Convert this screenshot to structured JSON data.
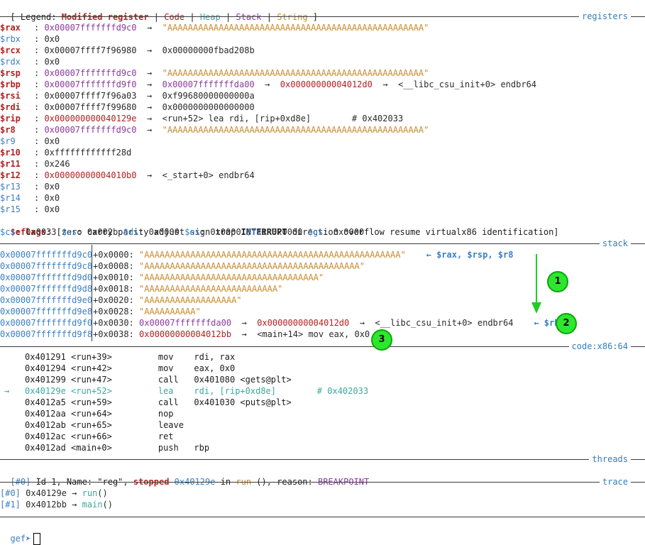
{
  "legend": {
    "open": "[ Legend: ",
    "modified": "Modified register",
    "sep": " | ",
    "code": "Code",
    "heap": "Heap",
    "stack": "Stack",
    "string": "String",
    "close": " ]"
  },
  "sections": {
    "registers": "registers",
    "stack": "stack",
    "code": "code:x86:64",
    "threads": "threads",
    "trace": "trace"
  },
  "registers": [
    {
      "name": "$rax",
      "mod": true,
      "value": "0x00007fffffffd9c0",
      "vclass": "purple",
      "chain": [
        {
          "t": "  →  ",
          "c": "ln"
        },
        {
          "t": "\"AAAAAAAAAAAAAAAAAAAAAAAAAAAAAAAAAAAAAAAAAAAAAAAAAA\"",
          "c": "str"
        }
      ]
    },
    {
      "name": "$rbx",
      "mod": false,
      "value": "0x0",
      "vclass": "ln",
      "chain": []
    },
    {
      "name": "$rcx",
      "mod": true,
      "value": "0x00007ffff7f96980",
      "vclass": "ln",
      "chain": [
        {
          "t": "  →  0x00000000fbad208b",
          "c": "ln"
        }
      ]
    },
    {
      "name": "$rdx",
      "mod": false,
      "value": "0x0",
      "vclass": "ln",
      "chain": []
    },
    {
      "name": "$rsp",
      "mod": true,
      "value": "0x00007fffffffd9c0",
      "vclass": "purple",
      "chain": [
        {
          "t": "  →  ",
          "c": "ln"
        },
        {
          "t": "\"AAAAAAAAAAAAAAAAAAAAAAAAAAAAAAAAAAAAAAAAAAAAAAAAAA\"",
          "c": "str"
        }
      ]
    },
    {
      "name": "$rbp",
      "mod": true,
      "value": "0x00007fffffffd9f0",
      "vclass": "purple",
      "chain": [
        {
          "t": "  →  ",
          "c": "ln"
        },
        {
          "t": "0x00007fffffffda00",
          "c": "purple"
        },
        {
          "t": "  →  ",
          "c": "ln"
        },
        {
          "t": "0x00000000004012d0",
          "c": "red"
        },
        {
          "t": "  →  <__libc_csu_init+0> endbr64",
          "c": "ln"
        }
      ]
    },
    {
      "name": "$rsi",
      "mod": true,
      "value": "0x00007ffff7f96a03",
      "vclass": "ln",
      "chain": [
        {
          "t": "  →  0xf99680000000000a",
          "c": "ln"
        }
      ]
    },
    {
      "name": "$rdi",
      "mod": true,
      "value": "0x00007ffff7f99680",
      "vclass": "ln",
      "chain": [
        {
          "t": "  →  0x0000000000000000",
          "c": "ln"
        }
      ]
    },
    {
      "name": "$rip",
      "mod": true,
      "value": "0x000000000040129e",
      "vclass": "red",
      "chain": [
        {
          "t": "  →  <run+52> lea rdi, [rip+0xd8e]        # 0x402033",
          "c": "ln"
        }
      ]
    },
    {
      "name": "$r8",
      "mod": true,
      "value": "0x00007fffffffd9c0",
      "vclass": "purple",
      "chain": [
        {
          "t": "  →  ",
          "c": "ln"
        },
        {
          "t": "\"AAAAAAAAAAAAAAAAAAAAAAAAAAAAAAAAAAAAAAAAAAAAAAAAAA\"",
          "c": "str"
        }
      ]
    },
    {
      "name": "$r9",
      "mod": false,
      "value": "0x0",
      "vclass": "ln",
      "chain": []
    },
    {
      "name": "$r10",
      "mod": true,
      "value": "0xffffffffffff28d",
      "vclass": "ln",
      "chain": []
    },
    {
      "name": "$r11",
      "mod": true,
      "value": "0x246",
      "vclass": "ln",
      "chain": []
    },
    {
      "name": "$r12",
      "mod": true,
      "value": "0x00000000004010b0",
      "vclass": "red",
      "chain": [
        {
          "t": "  →  <_start+0> endbr64",
          "c": "ln"
        }
      ]
    },
    {
      "name": "$r13",
      "mod": false,
      "value": "0x0",
      "vclass": "ln",
      "chain": []
    },
    {
      "name": "$r14",
      "mod": false,
      "value": "0x0",
      "vclass": "ln",
      "chain": []
    },
    {
      "name": "$r15",
      "mod": false,
      "value": "0x0",
      "vclass": "ln",
      "chain": []
    }
  ],
  "eflags": {
    "name": "$eflags",
    "pre": ": [zero carry parity adjust sign trap ",
    "bold": "INTERRUPT",
    "post": " direction overflow resume virtualx86 identification]"
  },
  "segments": [
    {
      "name": "$cs",
      "value": "0x0033"
    },
    {
      "name": "$ss",
      "value": "0x002b"
    },
    {
      "name": "$ds",
      "value": "0x0000"
    },
    {
      "name": "$es",
      "value": "0x0000"
    },
    {
      "name": "$fs",
      "value": "0x0000"
    },
    {
      "name": "$gs",
      "value": "0x0000"
    }
  ],
  "stack": [
    {
      "addr": "0x00007fffffffd9c0",
      "off": "+0x0000: ",
      "parts": [
        {
          "t": "\"AAAAAAAAAAAAAAAAAAAAAAAAAAAAAAAAAAAAAAAAAAAAAAAAAA\"",
          "c": "str"
        }
      ],
      "note": "    ← $rax, $rsp, $r8"
    },
    {
      "addr": "0x00007fffffffd9c8",
      "off": "+0x0008: ",
      "parts": [
        {
          "t": "\"AAAAAAAAAAAAAAAAAAAAAAAAAAAAAAAAAAAAAAAAAA\"",
          "c": "str"
        }
      ],
      "note": ""
    },
    {
      "addr": "0x00007fffffffd9d0",
      "off": "+0x0010: ",
      "parts": [
        {
          "t": "\"AAAAAAAAAAAAAAAAAAAAAAAAAAAAAAAAAA\"",
          "c": "str"
        }
      ],
      "note": ""
    },
    {
      "addr": "0x00007fffffffd9d8",
      "off": "+0x0018: ",
      "parts": [
        {
          "t": "\"AAAAAAAAAAAAAAAAAAAAAAAAAA\"",
          "c": "str"
        }
      ],
      "note": ""
    },
    {
      "addr": "0x00007fffffffd9e0",
      "off": "+0x0020: ",
      "parts": [
        {
          "t": "\"AAAAAAAAAAAAAAAAAA\"",
          "c": "str"
        }
      ],
      "note": ""
    },
    {
      "addr": "0x00007fffffffd9e8",
      "off": "+0x0028: ",
      "parts": [
        {
          "t": "\"AAAAAAAAAA\"",
          "c": "str"
        }
      ],
      "note": ""
    },
    {
      "addr": "0x00007fffffffd9f0",
      "off": "+0x0030: ",
      "parts": [
        {
          "t": "0x00007fffffffda00",
          "c": "purple"
        },
        {
          "t": "  →  ",
          "c": "ln"
        },
        {
          "t": "0x00000000004012d0",
          "c": "red"
        },
        {
          "t": "  →  <__libc_csu_init+0> endbr64",
          "c": "ln"
        }
      ],
      "note": "    ← $rbp"
    },
    {
      "addr": "0x00007fffffffd9f8",
      "off": "+0x0038: ",
      "parts": [
        {
          "t": "0x00000000004012bb",
          "c": "red"
        },
        {
          "t": "  →  <main+14> mov eax, 0x0",
          "c": "ln"
        }
      ],
      "note": ""
    }
  ],
  "code": [
    {
      "current": false,
      "text": "0x401291 <run+39>         mov    rdi, rax"
    },
    {
      "current": false,
      "text": "0x401294 <run+42>         mov    eax, 0x0"
    },
    {
      "current": false,
      "text": "0x401299 <run+47>         call   0x401080 <gets@plt>"
    },
    {
      "current": true,
      "text": "0x40129e <run+52>         lea    rdi, [rip+0xd8e]        # 0x402033"
    },
    {
      "current": false,
      "text": "0x4012a5 <run+59>         call   0x401030 <puts@plt>"
    },
    {
      "current": false,
      "text": "0x4012aa <run+64>         nop"
    },
    {
      "current": false,
      "text": "0x4012ab <run+65>         leave"
    },
    {
      "current": false,
      "text": "0x4012ac <run+66>         ret"
    },
    {
      "current": false,
      "text": "0x4012ad <main+0>         push   rbp"
    }
  ],
  "code_marker": "→",
  "thread": {
    "id": "[#0]",
    "t1": " Id 1, Name: \"reg\", ",
    "state": "stopped",
    "addr": "0x40129e",
    "t2": " in ",
    "fn": "run",
    "t3": " (), reason: ",
    "reason": "BREAKPOINT"
  },
  "trace": [
    {
      "id": "[#0]",
      "addr": " 0x40129e → ",
      "fn": "run",
      "tail": "()"
    },
    {
      "id": "[#1]",
      "addr": " 0x4012bb → ",
      "fn": "main",
      "tail": "()"
    }
  ],
  "prompt": "gef➤",
  "annotations": [
    "1",
    "2",
    "3"
  ],
  "colors": {
    "arrow": "#22cc22",
    "badge": "#2ee62e"
  }
}
